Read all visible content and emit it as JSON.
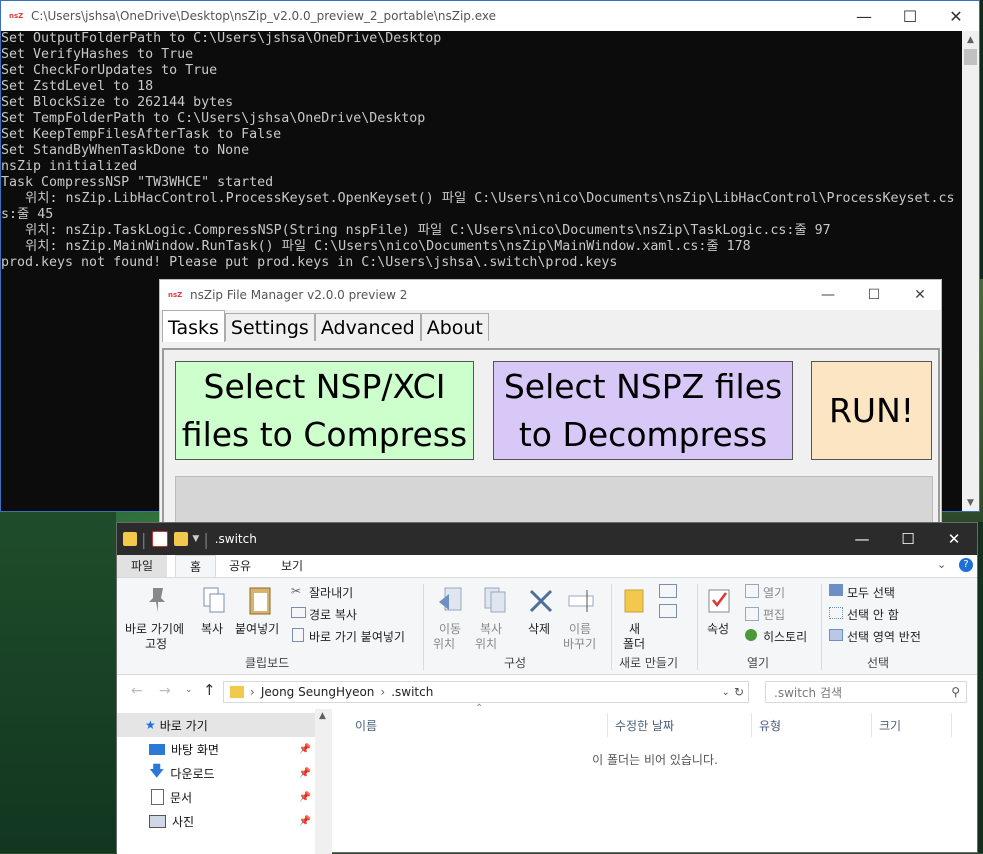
{
  "console": {
    "title": "C:\\Users\\jshsa\\OneDrive\\Desktop\\nsZip_v2.0.0_preview_2_portable\\nsZip.exe",
    "badge": "nsZ",
    "lines": [
      "Set OutputFolderPath to C:\\Users\\jshsa\\OneDrive\\Desktop",
      "Set VerifyHashes to True",
      "Set CheckForUpdates to True",
      "Set ZstdLevel to 18",
      "Set BlockSize to 262144 bytes",
      "Set TempFolderPath to C:\\Users\\jshsa\\OneDrive\\Desktop",
      "Set KeepTempFilesAfterTask to False",
      "Set StandByWhenTaskDone to None",
      "nsZip initialized",
      "Task CompressNSP \"TW3WHCE\" started",
      "   위치: nsZip.LibHacControl.ProcessKeyset.OpenKeyset() 파일 C:\\Users\\nico\\Documents\\nsZip\\LibHacControl\\ProcessKeyset.cs",
      "s:줄 45",
      "   위치: nsZip.TaskLogic.CompressNSP(String nspFile) 파일 C:\\Users\\nico\\Documents\\nsZip\\TaskLogic.cs:줄 97",
      "   위치: nsZip.MainWindow.RunTask() 파일 C:\\Users\\nico\\Documents\\nsZip\\MainWindow.xaml.cs:줄 178",
      "prod.keys not found! Please put prod.keys in C:\\Users\\jshsa\\.switch\\prod.keys"
    ]
  },
  "manager": {
    "title": "nsZip File Manager v2.0.0 preview 2",
    "badge": "nsZ",
    "tabs": [
      "Tasks",
      "Settings",
      "Advanced",
      "About"
    ],
    "compress_line1": "Select NSP/XCI",
    "compress_line2": "files to Compress",
    "decompress_line1": "Select NSPZ files",
    "decompress_line2": "to Decompress",
    "run_label": "RUN!",
    "colors": {
      "compress": "#ccffcc",
      "decompress": "#d8c8f8",
      "run": "#fce5c2"
    }
  },
  "explorer": {
    "title": ".switch",
    "ribbon_tabs": [
      "파일",
      "홈",
      "공유",
      "보기"
    ],
    "ribbon": {
      "pin_line1": "바로 가기에",
      "pin_line2": "고정",
      "copy": "복사",
      "paste": "붙여넣기",
      "cut": "잘라내기",
      "copy_path": "경로 복사",
      "paste_shortcut": "바로 가기 붙여넣기",
      "clipboard_group": "클립보드",
      "move_line1": "이동",
      "move_line2": "위치",
      "copyto_line1": "복사",
      "copyto_line2": "위치",
      "delete": "삭제",
      "rename_line1": "이름",
      "rename_line2": "바꾸기",
      "organize_group": "구성",
      "newfolder_line1": "새",
      "newfolder_line2": "폴더",
      "new_group": "새로 만들기",
      "properties": "속성",
      "open": "열기",
      "edit": "편집",
      "history": "히스토리",
      "open_group": "열기",
      "select_all": "모두 선택",
      "select_none": "선택 안 함",
      "invert": "선택 영역 반전",
      "select_group": "선택"
    },
    "address": {
      "parent": "Jeong SeungHyeon",
      "current": ".switch"
    },
    "search_placeholder": ".switch 검색",
    "nav": [
      "바로 가기",
      "바탕 화면",
      "다운로드",
      "문서",
      "사진"
    ],
    "columns": [
      "이름",
      "수정한 날짜",
      "유형",
      "크기"
    ],
    "empty_message": "이 폴더는 비어 있습니다."
  }
}
